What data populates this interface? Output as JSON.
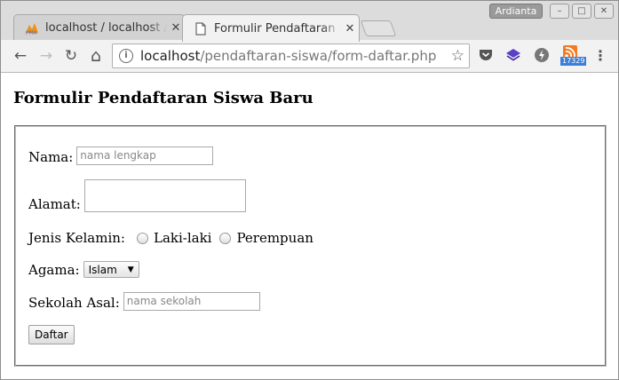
{
  "tabs": [
    {
      "title": "localhost / localhost / phpMyAdmin",
      "favicon": "phpmyadmin-icon",
      "close": "✕"
    },
    {
      "title": "Formulir Pendaftaran Siswa",
      "favicon": "page-icon",
      "close": "✕"
    }
  ],
  "window": {
    "user": "Ardianta",
    "minimize": "–",
    "maximize": "□",
    "close": "✕"
  },
  "toolbar": {
    "back": "←",
    "forward": "→",
    "reload": "↻",
    "home": "⌂",
    "url_host": "localhost",
    "url_path": "/pendaftaran-siswa/form-daftar.php",
    "bookmark": "☆",
    "rss_count": "17329",
    "menu": "⋮"
  },
  "page": {
    "heading": "Formulir Pendaftaran Siswa Baru",
    "nama_label": "Nama:",
    "nama_placeholder": "nama lengkap",
    "alamat_label": "Alamat:",
    "jk_label": "Jenis Kelamin:",
    "jk_options": [
      "Laki-laki",
      "Perempuan"
    ],
    "agama_label": "Agama:",
    "agama_selected": "Islam",
    "sekolah_label": "Sekolah Asal:",
    "sekolah_placeholder": "nama sekolah",
    "submit_label": "Daftar"
  }
}
